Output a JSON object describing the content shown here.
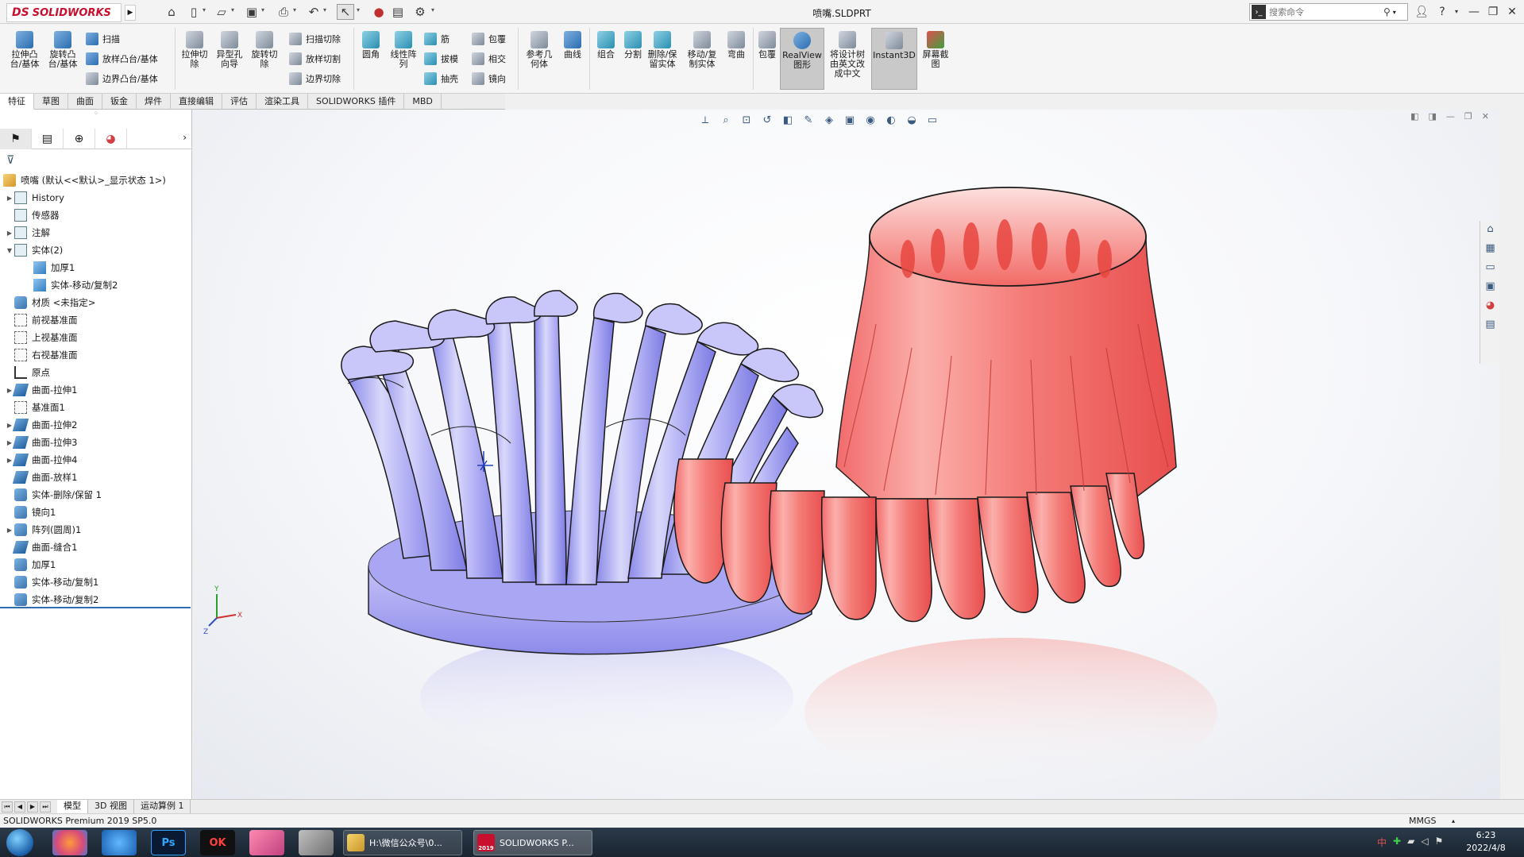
{
  "titlebar": {
    "logo_ds": "DS",
    "logo_text": "SOLIDWORKS",
    "doc_title": "喷嘴.SLDPRT",
    "search_placeholder": "搜索命令",
    "help": "?"
  },
  "ribbon": {
    "extrude_boss": "拉伸凸\n台/基体",
    "revolve_boss": "旋转凸\n台/基体",
    "sweep": "扫描",
    "loft_boss": "放样凸台/基体",
    "boundary_boss": "边界凸台/基体",
    "extrude_cut": "拉伸切\n除",
    "hole_wizard": "异型孔\n向导",
    "revolve_cut": "旋转切\n除",
    "sweep_cut": "扫描切除",
    "loft_cut": "放样切割",
    "boundary_cut": "边界切除",
    "fillet": "圆角",
    "linear_pattern": "线性阵\n列",
    "rib": "筋",
    "draft": "拔模",
    "shell": "抽壳",
    "wrap": "包覆",
    "intersect": "相交",
    "mirror": "镜向",
    "ref_geometry": "参考几\n何体",
    "curves": "曲线",
    "combine": "组合",
    "split": "分割",
    "delete_keep_body": "删除/保\n留实体",
    "move_copy_body": "移动/复\n制实体",
    "flex": "弯曲",
    "wrap2": "包覆",
    "realview": "RealView\n图形",
    "translate_tree": "将设计树\n由英文改\n成中文",
    "instant3d": "Instant3D",
    "screen_capture": "屏幕截\n图"
  },
  "tabs": [
    "特征",
    "草图",
    "曲面",
    "钣金",
    "焊件",
    "直接编辑",
    "评估",
    "渲染工具",
    "SOLIDWORKS 插件",
    "MBD"
  ],
  "active_tab": "特征",
  "tree": {
    "root": "喷嘴  (默认<<默认>_显示状态 1>)",
    "items": [
      {
        "label": "History",
        "icon": "folder-icon",
        "exp": "▶",
        "indent": 1
      },
      {
        "label": "传感器",
        "icon": "sensor-icon",
        "exp": "",
        "indent": 1
      },
      {
        "label": "注解",
        "icon": "annotation-icon",
        "exp": "▶",
        "indent": 1
      },
      {
        "label": "实体(2)",
        "icon": "solid-bodies-icon",
        "exp": "▼",
        "indent": 1
      },
      {
        "label": "加厚1",
        "icon": "body-icon",
        "exp": "",
        "indent": 2
      },
      {
        "label": "实体-移动/复制2",
        "icon": "body-icon",
        "exp": "",
        "indent": 2
      },
      {
        "label": "材质 <未指定>",
        "icon": "material-icon",
        "exp": "",
        "indent": 1
      },
      {
        "label": "前视基准面",
        "icon": "plane-icon",
        "exp": "",
        "indent": 1
      },
      {
        "label": "上视基准面",
        "icon": "plane-icon",
        "exp": "",
        "indent": 1
      },
      {
        "label": "右视基准面",
        "icon": "plane-icon",
        "exp": "",
        "indent": 1
      },
      {
        "label": "原点",
        "icon": "origin-icon",
        "exp": "",
        "indent": 1
      },
      {
        "label": "曲面-拉伸1",
        "icon": "surface-icon",
        "exp": "▶",
        "indent": 1
      },
      {
        "label": "基准面1",
        "icon": "plane-icon",
        "exp": "",
        "indent": 1
      },
      {
        "label": "曲面-拉伸2",
        "icon": "surface-icon",
        "exp": "▶",
        "indent": 1
      },
      {
        "label": "曲面-拉伸3",
        "icon": "surface-icon",
        "exp": "▶",
        "indent": 1
      },
      {
        "label": "曲面-拉伸4",
        "icon": "surface-icon",
        "exp": "▶",
        "indent": 1
      },
      {
        "label": "曲面-放样1",
        "icon": "surface-icon",
        "exp": "",
        "indent": 1
      },
      {
        "label": "实体-删除/保留 1",
        "icon": "feature-icon",
        "exp": "",
        "indent": 1
      },
      {
        "label": "镜向1",
        "icon": "feature-icon",
        "exp": "",
        "indent": 1
      },
      {
        "label": "阵列(圆周)1",
        "icon": "feature-icon",
        "exp": "▶",
        "indent": 1
      },
      {
        "label": "曲面-缝合1",
        "icon": "surface-icon",
        "exp": "",
        "indent": 1
      },
      {
        "label": "加厚1",
        "icon": "feature-icon",
        "exp": "",
        "indent": 1
      },
      {
        "label": "实体-移动/复制1",
        "icon": "feature-icon",
        "exp": "",
        "indent": 1
      },
      {
        "label": "实体-移动/复制2",
        "icon": "feature-icon",
        "exp": "",
        "indent": 1
      }
    ]
  },
  "model_tabs": [
    "模型",
    "3D 视图",
    "运动算例 1"
  ],
  "status": {
    "product": "SOLIDWORKS Premium 2019 SP5.0",
    "units": "MMGS"
  },
  "taskbar": {
    "ps_label": "Ps",
    "ok_label": "OK",
    "explorer_window": "H:\\微信公众号\\0...",
    "sw_window": "SOLIDWORKS P...",
    "sw_badge": "2019",
    "time": "6:23",
    "date": "2022/4/8"
  },
  "colors": {
    "blue_body": "#9a9af0",
    "red_body": "#f07070",
    "accent": "#2f6fb0",
    "brand": "#c8102e"
  }
}
